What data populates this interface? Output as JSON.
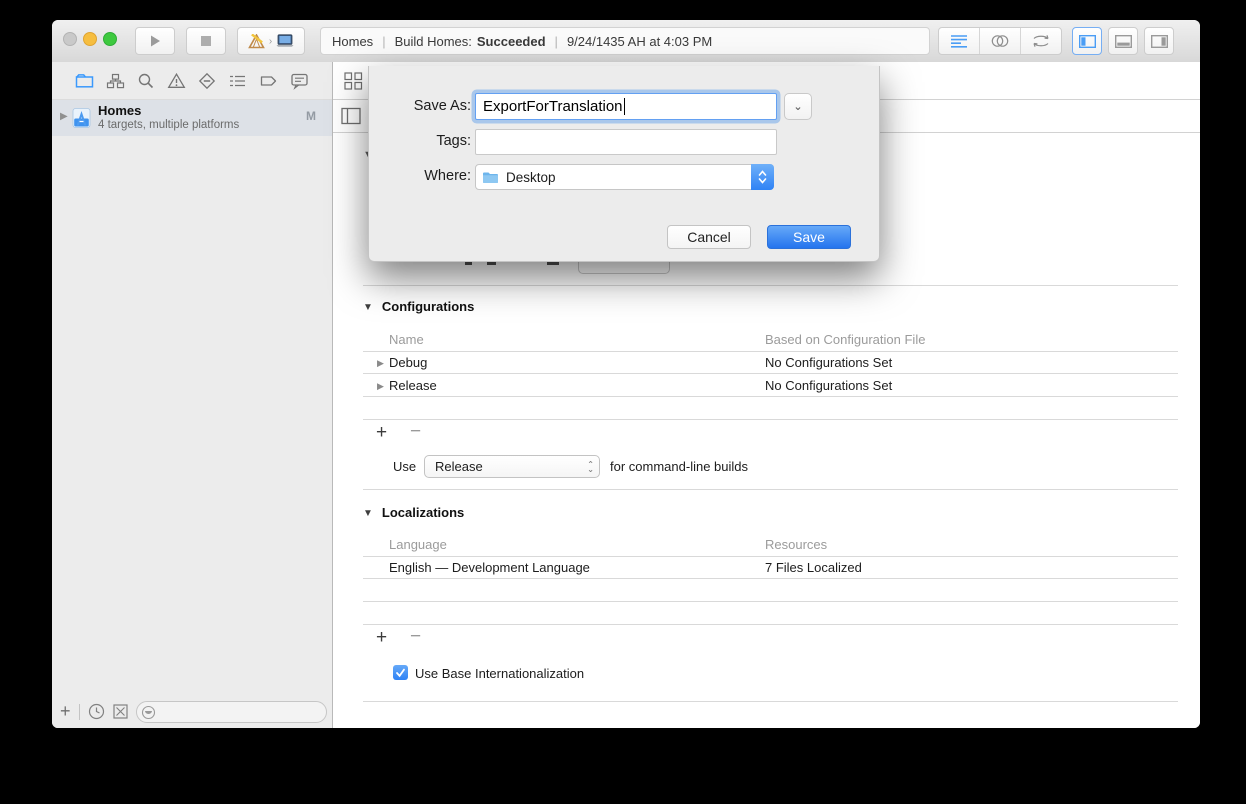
{
  "toolbar": {
    "status": {
      "project": "Homes",
      "divider": "|",
      "build_prefix": "Build Homes:",
      "build_status": "Succeeded",
      "timestamp": "9/24/1435 AH at 4:03 PM"
    }
  },
  "sidebar": {
    "project_name": "Homes",
    "project_subtitle": "4 targets, multiple platforms",
    "modified_badge": "M"
  },
  "dialog": {
    "save_as_label": "Save As:",
    "filename": "ExportForTranslation",
    "tags_label": "Tags:",
    "tags_value": "",
    "where_label": "Where:",
    "location": "Desktop",
    "cancel": "Cancel",
    "save": "Save"
  },
  "editor": {
    "configurations": {
      "title": "Configurations",
      "columns": [
        "Name",
        "Based on Configuration File"
      ],
      "rows": [
        {
          "name": "Debug",
          "file": "No Configurations Set"
        },
        {
          "name": "Release",
          "file": "No Configurations Set"
        }
      ],
      "use_prefix": "Use",
      "use_value": "Release",
      "use_suffix": "for command-line builds"
    },
    "localizations": {
      "title": "Localizations",
      "columns": [
        "Language",
        "Resources"
      ],
      "rows": [
        {
          "language": "English — Development Language",
          "resources": "7 Files Localized"
        }
      ],
      "base_checkbox_label": "Use Base Internationalization"
    }
  },
  "colors": {
    "accent": "#2e82f5",
    "selection": "#dde1e7",
    "icon_blue": "#3b99fc"
  }
}
